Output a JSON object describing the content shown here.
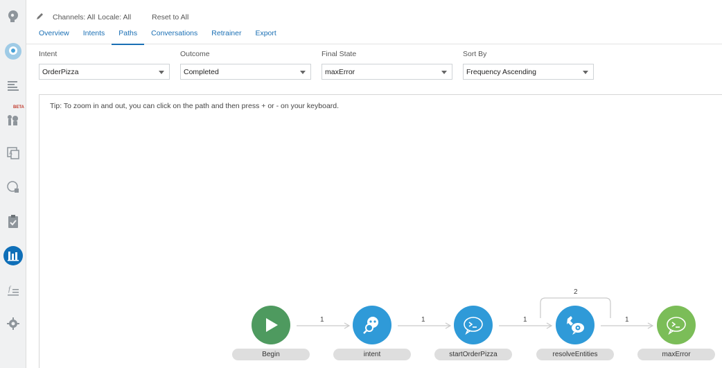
{
  "rail": {
    "beta_label": "BETA"
  },
  "header": {
    "channels_label": "Channels: All",
    "locale_label": "Locale: All",
    "reset_label": "Reset to All"
  },
  "tabs": [
    {
      "label": "Overview"
    },
    {
      "label": "Intents"
    },
    {
      "label": "Paths",
      "active": true
    },
    {
      "label": "Conversations"
    },
    {
      "label": "Retrainer"
    },
    {
      "label": "Export"
    }
  ],
  "filters": {
    "intent": {
      "label": "Intent",
      "value": "OrderPizza"
    },
    "outcome": {
      "label": "Outcome",
      "value": "Completed"
    },
    "final_state": {
      "label": "Final State",
      "value": "maxError"
    },
    "sort_by": {
      "label": "Sort By",
      "value": "Frequency Ascending"
    }
  },
  "canvas": {
    "tip": "Tip: To zoom in and out, you can click on the path and then press + or - on your keyboard."
  },
  "path": {
    "nodes": [
      {
        "label": "Begin",
        "icon": "play-icon",
        "color": "#4e9a5f"
      },
      {
        "label": "intent",
        "icon": "intent-search-icon",
        "color": "#2f9ad8"
      },
      {
        "label": "startOrderPizza",
        "icon": "prompt-bubble-icon",
        "color": "#2f9ad8"
      },
      {
        "label": "resolveEntities",
        "icon": "resolve-entities-icon",
        "color": "#2f9ad8"
      },
      {
        "label": "maxError",
        "icon": "prompt-bubble-icon",
        "color": "#7bbd58"
      }
    ],
    "edges": [
      {
        "label": "1"
      },
      {
        "label": "1"
      },
      {
        "label": "1"
      },
      {
        "label": "1"
      }
    ],
    "loop_label": "2"
  }
}
